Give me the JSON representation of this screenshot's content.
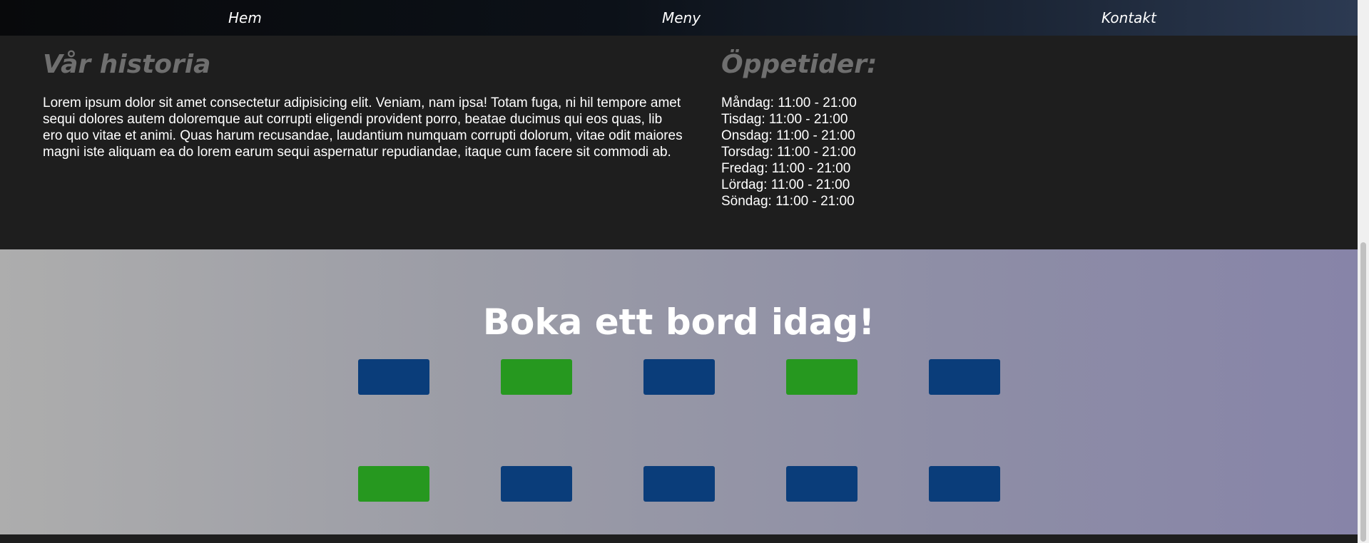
{
  "nav": {
    "home": "Hem",
    "menu": "Meny",
    "contact": "Kontakt"
  },
  "history": {
    "title": "Vår historia",
    "text": "Lorem ipsum dolor sit amet consectetur adipisicing elit. Veniam, nam ipsa! Totam fuga, ni hil tempore amet sequi dolores autem doloremque aut corrupti eligendi provident porro, beatae ducimus qui eos quas, lib ero quo vitae et animi. Quas harum recusandae, laudantium numquam corrupti dolorum, vitae odit maiores magni iste aliquam ea do lorem earum sequi aspernatur repudiandae, itaque cum facere sit commodi ab."
  },
  "hours": {
    "title": "Öppetider:",
    "days": [
      "Måndag: 11:00 - 21:00",
      "Tisdag: 11:00 - 21:00",
      "Onsdag: 11:00 - 21:00",
      "Torsdag: 11:00 - 21:00",
      "Fredag: 11:00 - 21:00",
      "Lördag: 11:00 - 21:00",
      "Söndag: 11:00 - 21:00"
    ]
  },
  "booking": {
    "title": "Boka ett bord idag!",
    "tables": [
      {
        "status": "booked",
        "color": "#0a3d7a"
      },
      {
        "status": "available",
        "color": "#26981f"
      },
      {
        "status": "booked",
        "color": "#0a3d7a"
      },
      {
        "status": "available",
        "color": "#26981f"
      },
      {
        "status": "booked",
        "color": "#0a3d7a"
      },
      {
        "status": "available",
        "color": "#26981f"
      },
      {
        "status": "booked",
        "color": "#0a3d7a"
      },
      {
        "status": "booked",
        "color": "#0a3d7a"
      },
      {
        "status": "booked",
        "color": "#0a3d7a"
      },
      {
        "status": "booked",
        "color": "#0a3d7a"
      }
    ]
  }
}
